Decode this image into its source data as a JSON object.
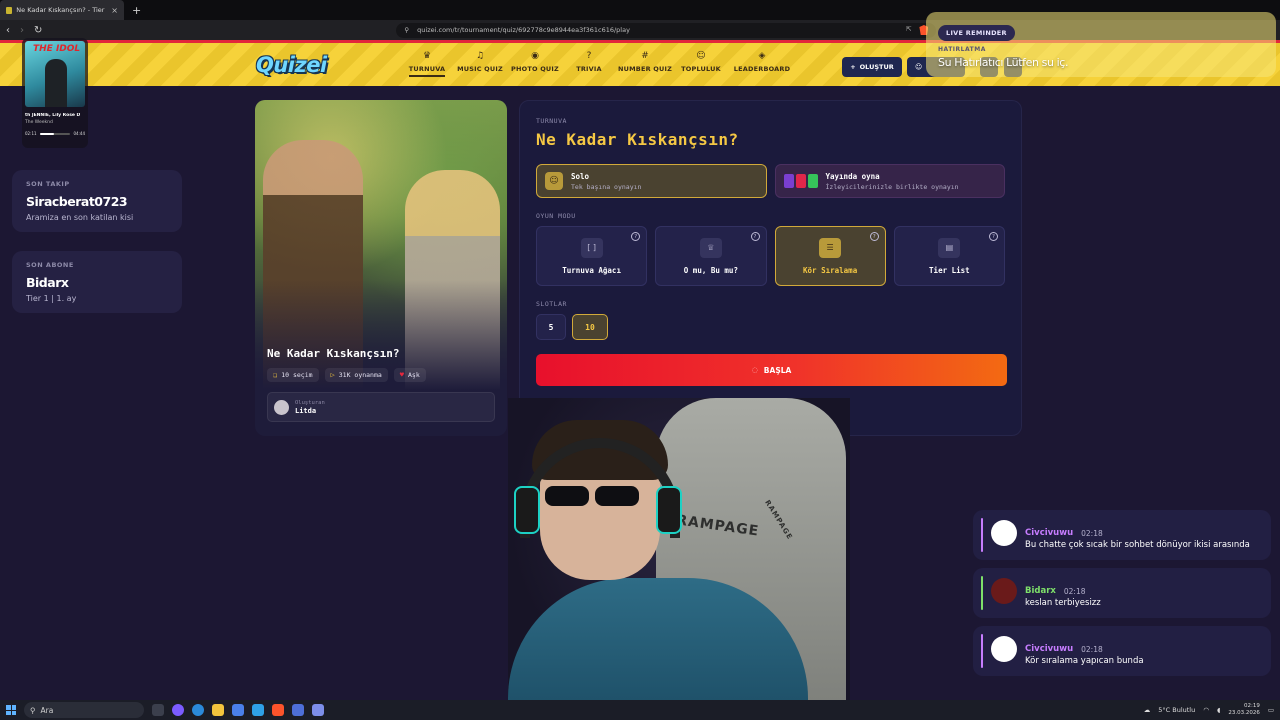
{
  "browser": {
    "tab_title": "Ne Kadar Kıskançsın? - Tier List",
    "url": "quizei.com/tr/tournament/quiz/692778c9e8944ea3f361c616/play"
  },
  "site": {
    "logo": "Quizei",
    "nav": [
      {
        "label": "TURNUVA",
        "icon": "♛",
        "name": "nav-turnuva"
      },
      {
        "label": "MUSIC QUIZ",
        "icon": "♫",
        "name": "nav-music-quiz"
      },
      {
        "label": "PHOTO QUIZ",
        "icon": "◉",
        "name": "nav-photo-quiz"
      },
      {
        "label": "TRIVIA",
        "icon": "?",
        "name": "nav-trivia"
      },
      {
        "label": "NUMBER QUIZ",
        "icon": "#",
        "name": "nav-number-quiz"
      },
      {
        "label": "TOPLULUK",
        "icon": "☺",
        "name": "nav-topluluk"
      },
      {
        "label": "LEADERBOARD",
        "icon": "◈",
        "name": "nav-leaderboard"
      }
    ],
    "create_label": "OLUŞTUR"
  },
  "reminder": {
    "pill": "LIVE REMINDER",
    "sub": "HATIRLATMA",
    "message": "Su Hatırlatıcı Lütfen su iç."
  },
  "now_playing": {
    "cover_title": "THE IDOL",
    "song": "th JENNIE, Lily Rose D",
    "artist": "The Weeknd",
    "elapsed": "02:11",
    "total": "04:44",
    "progress": 0.48
  },
  "alerts": {
    "follower": {
      "caption": "SON TAKIP",
      "name": "Siracberat0723",
      "desc": "Aramiza en son katilan kisi"
    },
    "subscriber": {
      "caption": "SON ABONE",
      "name": "Bidarx",
      "desc": "Tier 1 | 1. ay"
    }
  },
  "quiz": {
    "title": "Ne Kadar Kıskançsın?",
    "stats": [
      {
        "icon": "❏",
        "text": "10 seçim"
      },
      {
        "icon": "▷",
        "text": "31K oynanma"
      },
      {
        "icon": "♥",
        "text": "Aşk"
      }
    ],
    "author_caption": "Oluşturan",
    "author": "Litda",
    "category_caption": "TURNUVA",
    "play_options": [
      {
        "title": "Solo",
        "desc": "Tek başına oynayın"
      },
      {
        "title": "Yayında oyna",
        "desc": "İzleyicilerinizle birlikte oynayın"
      }
    ],
    "mode_caption": "OYUN MODU",
    "modes": [
      {
        "label": "Turnuva Ağacı",
        "icon": "[ ]"
      },
      {
        "label": "O mu, Bu mu?",
        "icon": "♕"
      },
      {
        "label": "Kör Sıralama",
        "icon": "☰"
      },
      {
        "label": "Tier List",
        "icon": "▤"
      }
    ],
    "active_mode": "Kör Sıralama",
    "slots_caption": "SLOTLAR",
    "slots": [
      "5",
      "10"
    ],
    "active_slot": "10",
    "start_label": "BAŞLA"
  },
  "webcam": {
    "chair_brand": "RAMPAGE"
  },
  "chat": [
    {
      "user": "Civcivuwu",
      "time": "02:18",
      "text": "Bu chatte çok sıcak bir sohbet dönüyor ikisi arasında",
      "color": "#c77dff"
    },
    {
      "user": "Bidarx",
      "time": "02:18",
      "text": "keslan terbiyesizz",
      "color": "#7ee06a"
    },
    {
      "user": "Civcivuwu",
      "time": "02:18",
      "text": "Kör sıralama yapıcan bunda",
      "color": "#c77dff"
    }
  ],
  "taskbar": {
    "search_placeholder": "Ara",
    "weather": "5°C Bulutlu",
    "time": "02:19",
    "date": "23.03.2026"
  }
}
